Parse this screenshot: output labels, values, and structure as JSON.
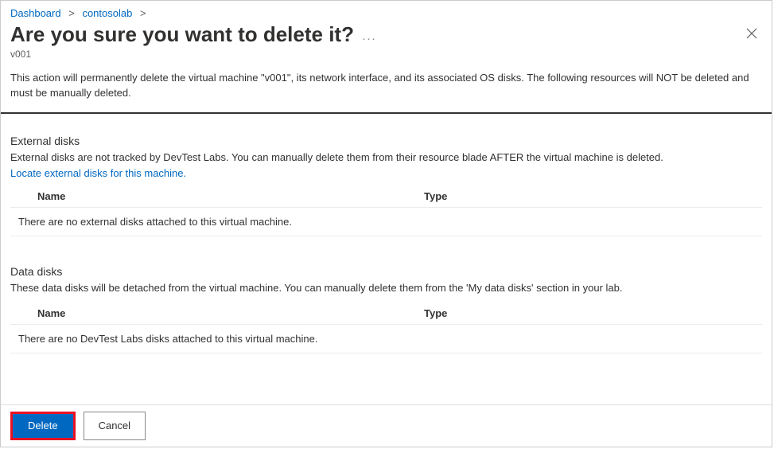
{
  "breadcrumb": {
    "items": [
      {
        "label": "Dashboard"
      },
      {
        "label": "contosolab"
      }
    ]
  },
  "header": {
    "title": "Are you sure you want to delete it?",
    "more_label": "···",
    "subtitle": "v001"
  },
  "description": "This action will permanently delete the virtual machine \"v001\", its network interface, and its associated OS disks. The following resources will NOT be deleted and must be manually deleted.",
  "external_disks": {
    "heading": "External disks",
    "desc": "External disks are not tracked by DevTest Labs. You can manually delete them from their resource blade AFTER the virtual machine is deleted.",
    "link": "Locate external disks for this machine.",
    "columns": {
      "name": "Name",
      "type": "Type"
    },
    "empty": "There are no external disks attached to this virtual machine."
  },
  "data_disks": {
    "heading": "Data disks",
    "desc": "These data disks will be detached from the virtual machine. You can manually delete them from the 'My data disks' section in your lab.",
    "columns": {
      "name": "Name",
      "type": "Type"
    },
    "empty": "There are no DevTest Labs disks attached to this virtual machine."
  },
  "footer": {
    "delete": "Delete",
    "cancel": "Cancel"
  }
}
